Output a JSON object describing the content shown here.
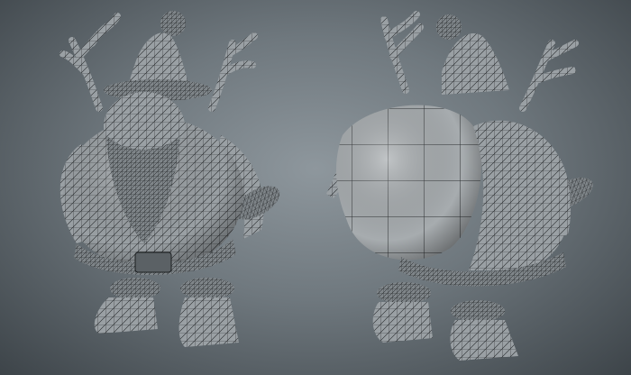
{
  "scene": {
    "background_top": "#8e979d",
    "background_bottom": "#3d4449",
    "model_fill": "#9aa0a4",
    "wire_color": "#1b1e20"
  },
  "figures": [
    {
      "view": "front"
    },
    {
      "view": "back"
    }
  ]
}
